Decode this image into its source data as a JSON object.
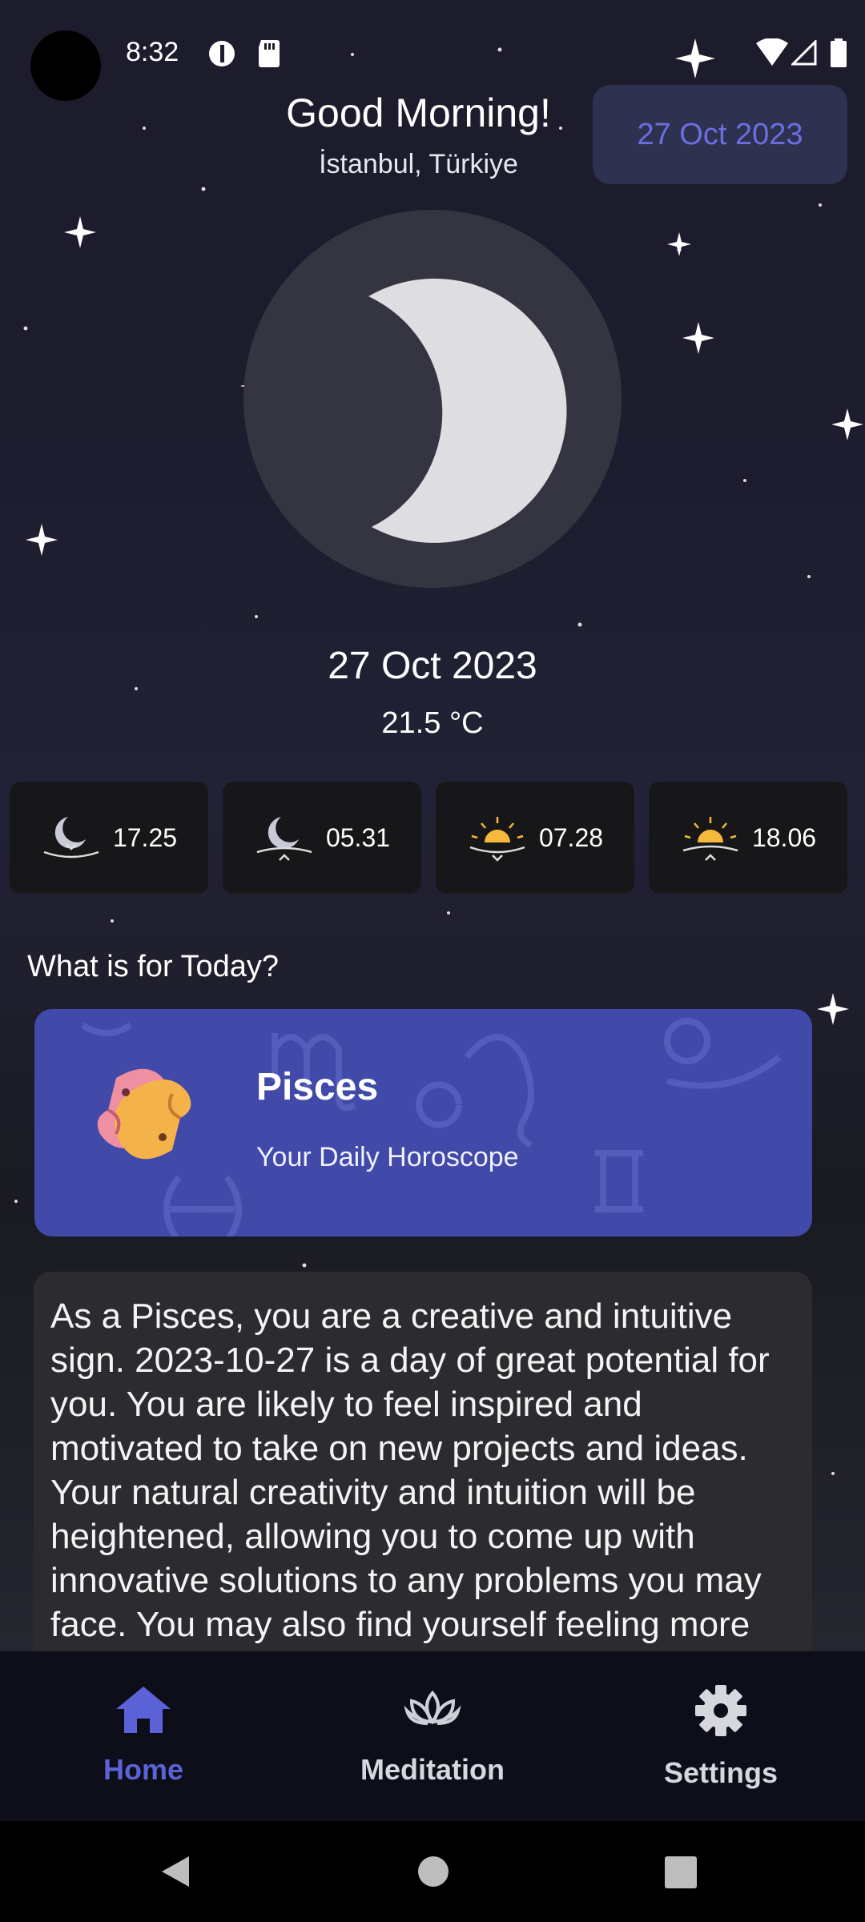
{
  "status_bar": {
    "time": "8:32",
    "left_icons": [
      "data-saver-icon",
      "sd-card-icon"
    ],
    "right_icons": [
      "wifi-icon",
      "signal-icon",
      "battery-icon"
    ]
  },
  "header": {
    "greeting": "Good Morning!",
    "location": "İstanbul, Türkiye",
    "date_chip": "27 Oct 2023"
  },
  "moon": {
    "phase_icon": "crescent-moon-icon"
  },
  "today": {
    "date": "27 Oct 2023",
    "temperature": "21.5 °C"
  },
  "celestial_times": [
    {
      "icon": "moonset-icon",
      "value": "17.25"
    },
    {
      "icon": "moonrise-icon",
      "value": "05.31"
    },
    {
      "icon": "sunrise-icon",
      "value": "07.28"
    },
    {
      "icon": "sunset-icon",
      "value": "18.06"
    }
  ],
  "section": {
    "title": "What is for Today?"
  },
  "horoscope": {
    "sign": "Pisces",
    "subtitle": "Your Daily Horoscope",
    "icon": "pisces-fish-icon",
    "text": "As a Pisces, you are a creative and intuitive sign. 2023-10-27 is a day of great potential for you. You are likely to feel inspired and motivated to take on new projects and ideas. Your natural creativity and intuition will be heightened, allowing you to come up with innovative solutions to any problems you may face. You may also find yourself feeling more connected to your inner self and your spiritual side today."
  },
  "bottom_nav": {
    "items": [
      {
        "label": "Home",
        "icon": "home-icon",
        "active": true
      },
      {
        "label": "Meditation",
        "icon": "lotus-icon",
        "active": false
      },
      {
        "label": "Settings",
        "icon": "gear-icon",
        "active": false
      }
    ]
  },
  "colors": {
    "accent": "#5b62d6",
    "card_purple": "#4149a9",
    "date_chip_bg": "#2f3150",
    "background": "#1c1c2c"
  }
}
